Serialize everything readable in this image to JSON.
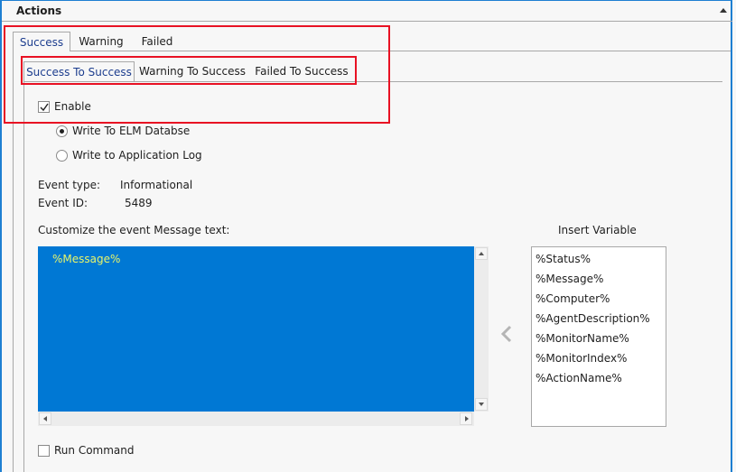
{
  "header": {
    "title": "Actions"
  },
  "outer_tabs": [
    {
      "label": "Success",
      "active": true
    },
    {
      "label": "Warning",
      "active": false
    },
    {
      "label": "Failed",
      "active": false
    }
  ],
  "inner_tabs": [
    {
      "label": "Success To Success",
      "active": true
    },
    {
      "label": "Warning To Success",
      "active": false
    },
    {
      "label": "Failed To Success",
      "active": false
    }
  ],
  "enable": {
    "label": "Enable",
    "checked": true
  },
  "write_options": [
    {
      "label": "Write To ELM Databse",
      "selected": true
    },
    {
      "label": "Write to Application Log",
      "selected": false
    }
  ],
  "event": {
    "type_label": "Event type:",
    "type_value": "Informational",
    "id_label": "Event ID:",
    "id_value": "5489"
  },
  "message": {
    "label": "Customize the event Message text:",
    "value": "%Message%",
    "editor_bg": "#0078d4",
    "text_color": "#e8f56a"
  },
  "insert_variable": {
    "title": "Insert Variable",
    "button_icon": "chevron-left-icon",
    "items": [
      "%Status%",
      "%Message%",
      "%Computer%",
      "%AgentDescription%",
      "%MonitorName%",
      "%MonitorIndex%",
      "%ActionName%"
    ]
  },
  "run_command": {
    "label": "Run Command",
    "checked": false
  },
  "colors": {
    "accent": "#1e7fd2",
    "highlight_box": "#e81123"
  }
}
